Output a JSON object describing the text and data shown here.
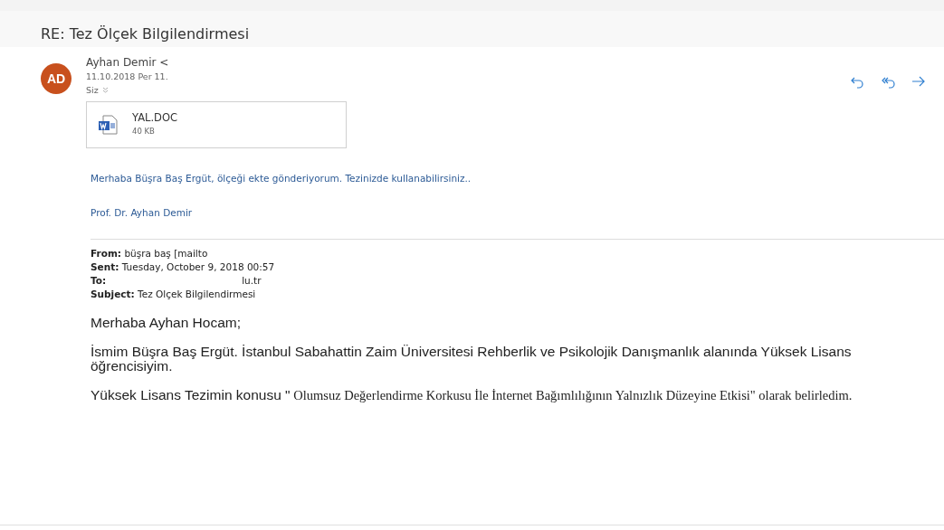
{
  "subject": "RE: Tez Ölçek Bilgilendirmesi",
  "message": {
    "avatar_initials": "AD",
    "sender": "Ayhan Demir <",
    "date": "11.10.2018 Per 11.",
    "recipients": "Siz",
    "actions": [
      {
        "kind": "reply"
      },
      {
        "kind": "reply-all"
      },
      {
        "kind": "forward"
      }
    ],
    "attachment": {
      "name": "YAL.DOC",
      "size": "40 KB"
    },
    "reply_lines": [
      "Merhaba Büşra Baş Ergüt, ölçeği ekte gönderiyorum. Tezinizde kullanabilirsiniz..",
      "Prof. Dr. Ayhan Demir"
    ],
    "quoted_header": [
      "**From:** büşra baş [mailto",
      "**Sent:** Tuesday, October 9, 2018 00:57",
      "**To:**",
      "**Subject:** Tez Olçek Bilgilendirmesi"
    ],
    "quoted_to_value": "lu.tr",
    "quoted_paragraphs": [
      [
        {
          "kind": "sans",
          "text": "Merhaba Ayhan Hocam;"
        }
      ],
      [
        {
          "kind": "sans",
          "text": "İsmim Büşra Baş Ergüt. İstanbul Sabahattin Zaim Üniversitesi Rehberlik ve Psikolojik Danışmanlık alanında Yüksek Lisans öğrencisiyim."
        }
      ],
      [
        {
          "kind": "sans",
          "text": "Yüksek Lisans Tezimin konusu \""
        },
        {
          "kind": "serif",
          "text": " Olumsuz Değerlendirme Korkusu İle İnternet Bağımlılığının Yalnızlık Düzeyine Etkisi\" olarak belirledim."
        }
      ]
    ]
  }
}
